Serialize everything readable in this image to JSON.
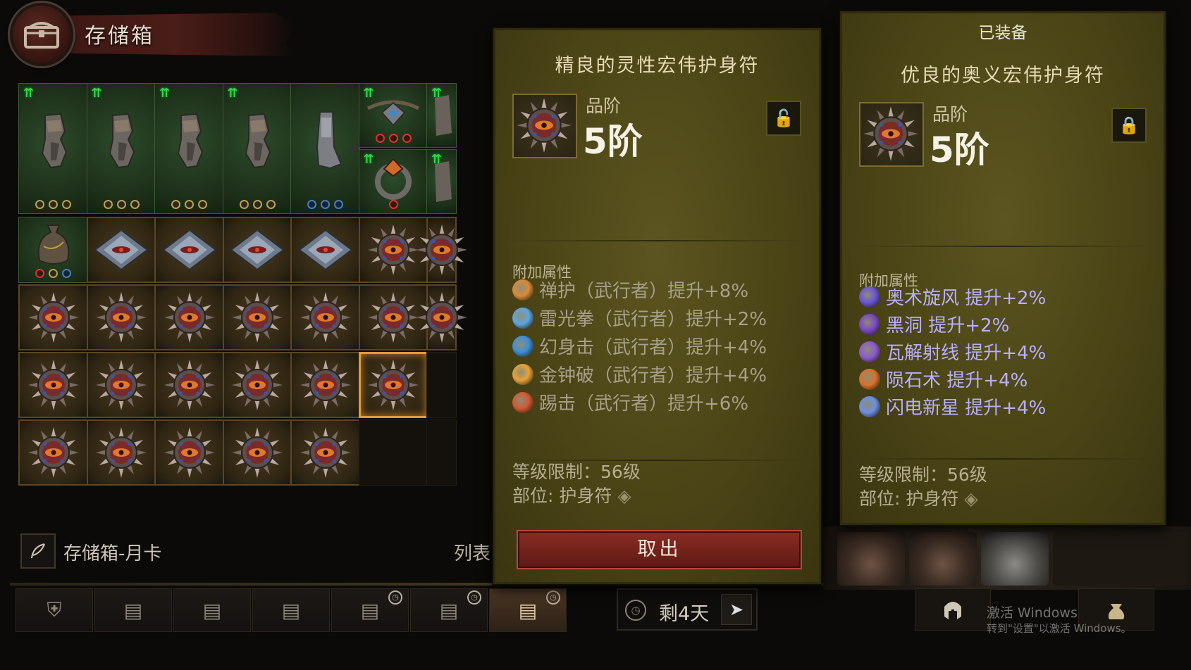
{
  "header": {
    "title": "存储箱"
  },
  "grid": {
    "cells": [
      {
        "col": 0,
        "row": 0,
        "type": "green",
        "item": "gloves",
        "arrow": true,
        "sockets": [
          "gold",
          "gold",
          "gold"
        ]
      },
      {
        "col": 1,
        "row": 0,
        "type": "green",
        "item": "gloves",
        "arrow": true,
        "sockets": [
          "gold",
          "gold",
          "gold"
        ]
      },
      {
        "col": 2,
        "row": 0,
        "type": "green",
        "item": "gloves",
        "arrow": true,
        "sockets": [
          "gold",
          "gold",
          "gold"
        ]
      },
      {
        "col": 3,
        "row": 0,
        "type": "green",
        "item": "gloves",
        "arrow": true,
        "sockets": [
          "gold",
          "gold",
          "gold"
        ]
      },
      {
        "col": 4,
        "row": 0,
        "type": "green",
        "item": "boots",
        "arrow": false,
        "sockets": [
          "blue",
          "blue",
          "blue"
        ]
      },
      {
        "col": 5,
        "row": 0,
        "type": "green",
        "item": "amulet-small",
        "arrow": true,
        "sockets": [
          "red",
          "red",
          "red"
        ]
      },
      {
        "col": 6,
        "row": 0,
        "type": "green",
        "item": "partial",
        "arrow": true,
        "sockets": []
      },
      {
        "col": 5,
        "row": 1,
        "type": "green",
        "item": "ring",
        "arrow": true,
        "sockets": [
          "red"
        ]
      },
      {
        "col": 6,
        "row": 1,
        "type": "green",
        "item": "partial",
        "arrow": true,
        "sockets": []
      },
      {
        "col": 0,
        "row": 2,
        "type": "green",
        "item": "pouch",
        "arrow": false,
        "sockets": [
          "red",
          "gold",
          "blue"
        ]
      },
      {
        "col": 1,
        "row": 2,
        "type": "gold",
        "item": "gem",
        "arrow": false,
        "sockets": []
      },
      {
        "col": 2,
        "row": 2,
        "type": "gold",
        "item": "gem",
        "arrow": false,
        "sockets": []
      },
      {
        "col": 3,
        "row": 2,
        "type": "gold",
        "item": "gem",
        "arrow": false,
        "sockets": []
      },
      {
        "col": 4,
        "row": 2,
        "type": "gold",
        "item": "gem",
        "arrow": false,
        "sockets": []
      },
      {
        "col": 5,
        "row": 2,
        "type": "gold",
        "item": "talisman",
        "arrow": false,
        "sockets": []
      },
      {
        "col": 6,
        "row": 2,
        "type": "gold",
        "item": "talisman",
        "arrow": false,
        "sockets": []
      },
      {
        "col": 0,
        "row": 3,
        "type": "gold",
        "item": "talisman",
        "arrow": false,
        "sockets": []
      },
      {
        "col": 1,
        "row": 3,
        "type": "gold",
        "item": "talisman",
        "arrow": false,
        "sockets": []
      },
      {
        "col": 2,
        "row": 3,
        "type": "gold",
        "item": "talisman",
        "arrow": false,
        "sockets": []
      },
      {
        "col": 3,
        "row": 3,
        "type": "gold",
        "item": "talisman",
        "arrow": false,
        "sockets": []
      },
      {
        "col": 4,
        "row": 3,
        "type": "gold",
        "item": "talisman",
        "arrow": false,
        "sockets": []
      },
      {
        "col": 5,
        "row": 3,
        "type": "gold",
        "item": "talisman",
        "arrow": false,
        "sockets": []
      },
      {
        "col": 6,
        "row": 3,
        "type": "gold",
        "item": "talisman",
        "arrow": false,
        "sockets": []
      },
      {
        "col": 0,
        "row": 4,
        "type": "gold",
        "item": "talisman",
        "arrow": false,
        "sockets": []
      },
      {
        "col": 1,
        "row": 4,
        "type": "gold",
        "item": "talisman",
        "arrow": false,
        "sockets": []
      },
      {
        "col": 2,
        "row": 4,
        "type": "gold",
        "item": "talisman",
        "arrow": false,
        "sockets": []
      },
      {
        "col": 3,
        "row": 4,
        "type": "gold",
        "item": "talisman",
        "arrow": false,
        "sockets": []
      },
      {
        "col": 4,
        "row": 4,
        "type": "gold",
        "item": "talisman",
        "arrow": false,
        "sockets": []
      },
      {
        "col": 5,
        "row": 4,
        "type": "selected",
        "item": "talisman",
        "arrow": false,
        "sockets": []
      },
      {
        "col": 6,
        "row": 4,
        "type": "empty",
        "item": "",
        "arrow": false,
        "sockets": []
      },
      {
        "col": 0,
        "row": 5,
        "type": "gold",
        "item": "talisman",
        "arrow": false,
        "sockets": []
      },
      {
        "col": 1,
        "row": 5,
        "type": "gold",
        "item": "talisman",
        "arrow": false,
        "sockets": []
      },
      {
        "col": 2,
        "row": 5,
        "type": "gold",
        "item": "talisman",
        "arrow": false,
        "sockets": []
      },
      {
        "col": 3,
        "row": 5,
        "type": "gold",
        "item": "talisman",
        "arrow": false,
        "sockets": []
      },
      {
        "col": 4,
        "row": 5,
        "type": "gold",
        "item": "talisman",
        "arrow": false,
        "sockets": []
      },
      {
        "col": 5,
        "row": 5,
        "type": "empty",
        "item": "",
        "arrow": false,
        "sockets": []
      },
      {
        "col": 6,
        "row": 5,
        "type": "empty",
        "item": "",
        "arrow": false,
        "sockets": []
      }
    ]
  },
  "footer": {
    "stash_label": "存储箱-月卡",
    "list_label": "列表",
    "feather_icon": "feather-icon"
  },
  "tabs": [
    {
      "icon": "armor-icon",
      "glyph": "⛨",
      "clock": false
    },
    {
      "icon": "chest-icon",
      "glyph": "▤",
      "clock": false
    },
    {
      "icon": "chest-icon",
      "glyph": "▤",
      "clock": false
    },
    {
      "icon": "chest-icon",
      "glyph": "▤",
      "clock": false
    },
    {
      "icon": "timed-chest-icon",
      "glyph": "▤",
      "clock": true
    },
    {
      "icon": "timed-chest-icon",
      "glyph": "▤",
      "clock": true
    },
    {
      "icon": "timed-chest-icon",
      "glyph": "▤",
      "clock": true,
      "active": true
    }
  ],
  "timer": {
    "text": "剩4天",
    "clock_glyph": "◷",
    "send_glyph": "➤"
  },
  "watermark": {
    "line1": "激活 Windows",
    "line2": "转到\"设置\"以激活 Windows。"
  },
  "compare_item": {
    "name": "精良的灵性宏伟护身符",
    "tier_label": "品阶",
    "tier_value": "5阶",
    "lock_glyph": "🔓",
    "section": "附加属性",
    "affixes": [
      {
        "text": "禅护（武行者）提升+8%",
        "color": "#d98a3a"
      },
      {
        "text": "雷光拳（武行者）提升+2%",
        "color": "#5da6e0"
      },
      {
        "text": "幻身击（武行者）提升+4%",
        "color": "#3c8ed8"
      },
      {
        "text": "金钟破（武行者）提升+4%",
        "color": "#e6a23a"
      },
      {
        "text": "踢击（武行者）提升+6%",
        "color": "#d05a34"
      }
    ],
    "level_req": "等级限制：56级",
    "slot": "部位: 护身符",
    "take_button": "取出"
  },
  "equipped_item": {
    "header": "已装备",
    "name": "优良的奥义宏伟护身符",
    "tier_label": "品阶",
    "tier_value": "5阶",
    "lock_glyph": "🔒",
    "section": "附加属性",
    "affixes": [
      {
        "text": "奥术旋风  提升+2%",
        "color": "#6a54d8"
      },
      {
        "text": "黑洞  提升+2%",
        "color": "#7848c8"
      },
      {
        "text": "瓦解射线  提升+4%",
        "color": "#8c5ad0"
      },
      {
        "text": "陨石术  提升+4%",
        "color": "#d9712e"
      },
      {
        "text": "闪电新星  提升+4%",
        "color": "#6b8fe2"
      }
    ],
    "level_req": "等级限制：56级",
    "slot": "部位: 护身符"
  },
  "colors": {
    "tooltip_bg": "#4a4416",
    "button_red": "#8a2c23",
    "affix_blue": "#b9b0ff"
  }
}
